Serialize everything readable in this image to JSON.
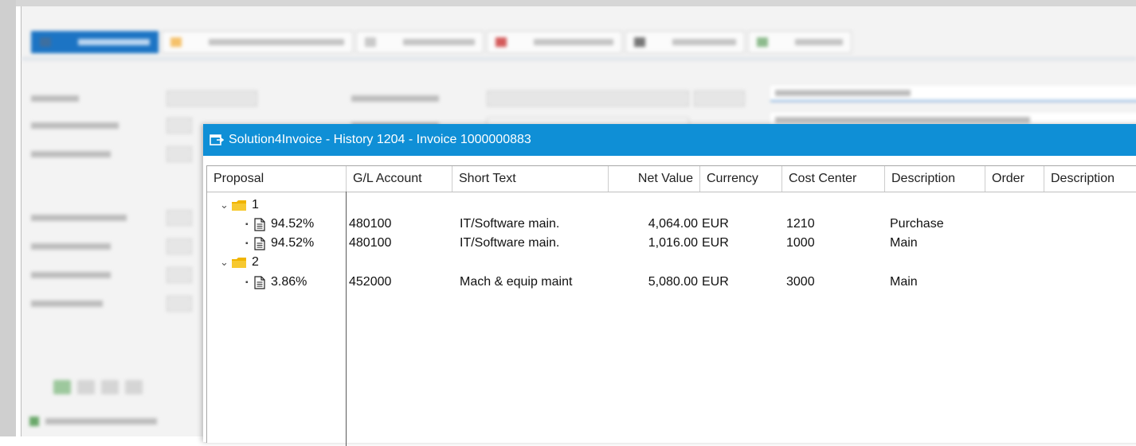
{
  "dialog": {
    "title": "Solution4Invoice - History 1204 - Invoice 1000000883"
  },
  "columns": {
    "proposal": "Proposal",
    "gl_account": "G/L Account",
    "short_text": "Short Text",
    "net_value": "Net Value",
    "currency": "Currency",
    "cost_center": "Cost Center",
    "description": "Description",
    "order": "Order",
    "description2": "Description"
  },
  "groups": [
    {
      "label": "1",
      "items": [
        {
          "proposal": "94.52%",
          "gl_account": "480100",
          "short_text": "IT/Software main.",
          "net_value": "4,064.00",
          "currency": "EUR",
          "cost_center": "1210",
          "description": "Purchase"
        },
        {
          "proposal": "94.52%",
          "gl_account": "480100",
          "short_text": "IT/Software main.",
          "net_value": "1,016.00",
          "currency": "EUR",
          "cost_center": "1000",
          "description": "Main"
        }
      ]
    },
    {
      "label": "2",
      "items": [
        {
          "proposal": "3.86%",
          "gl_account": "452000",
          "short_text": "Mach & equip maint",
          "net_value": "5,080.00",
          "currency": "EUR",
          "cost_center": "3000",
          "description": "Main"
        }
      ]
    }
  ],
  "icons": {
    "tree_expanded": "chevron-down-icon",
    "group": "folder-icon",
    "item": "document-icon",
    "window": "window-icon"
  },
  "colors": {
    "titlebar": "#0f8fd6",
    "folder": "#f0b400"
  }
}
